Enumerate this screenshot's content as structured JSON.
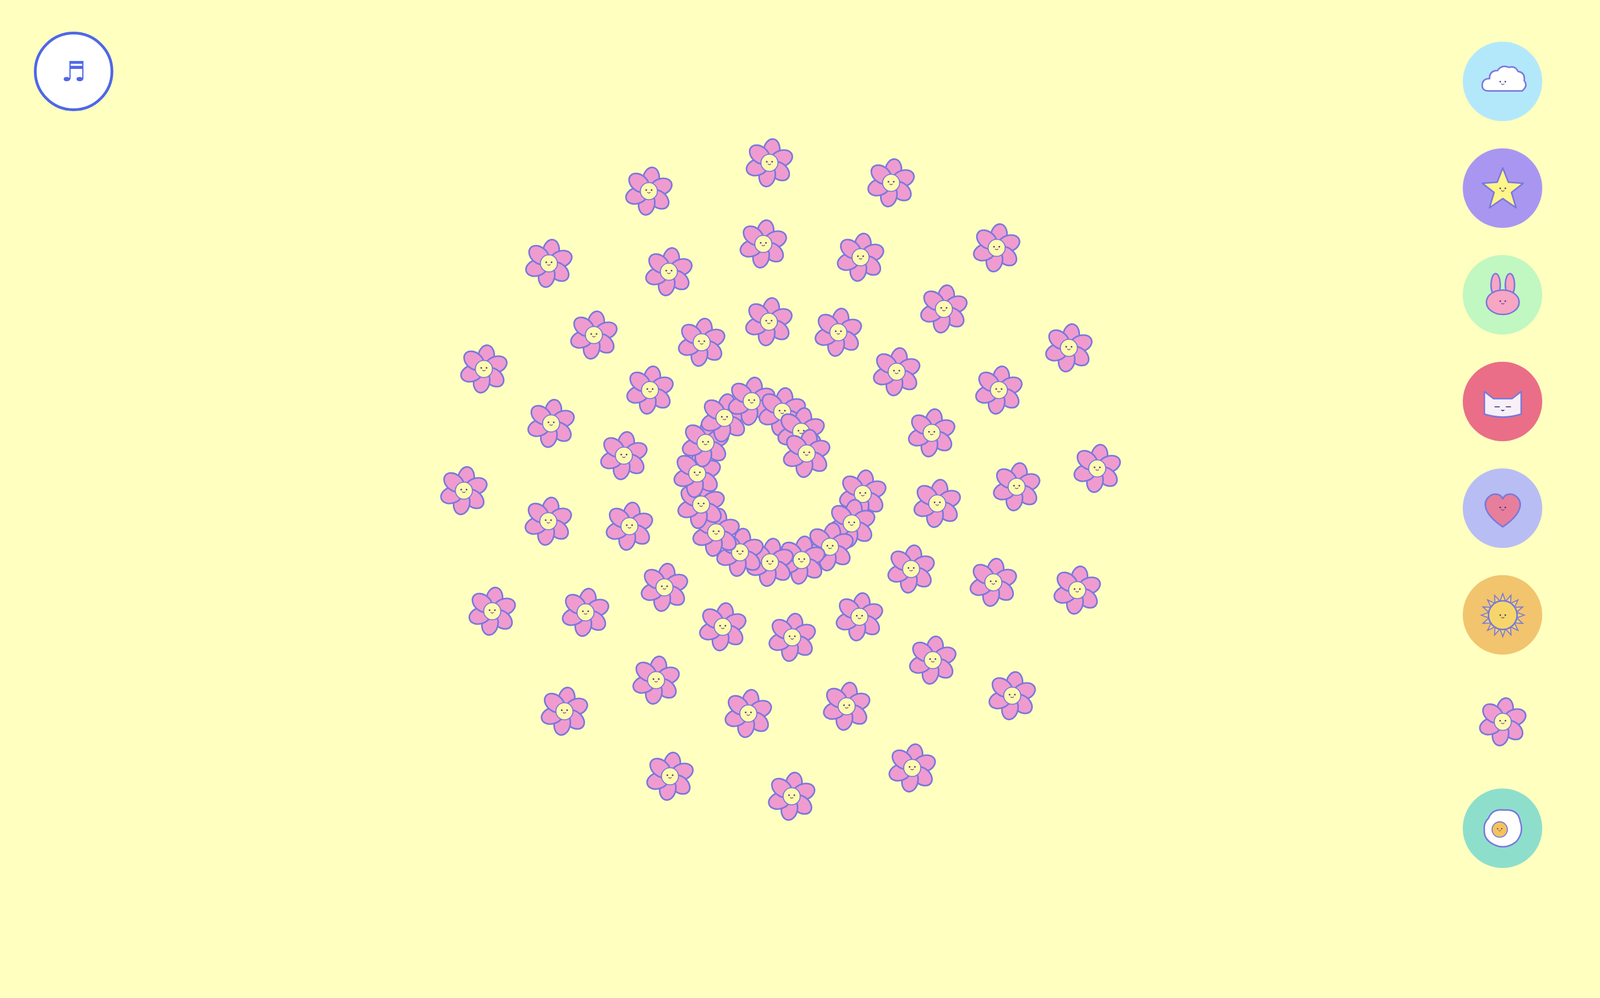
{
  "music_button": {
    "icon": "♬"
  },
  "stamp_palette": [
    {
      "kind": "cloud",
      "selected": false
    },
    {
      "kind": "star",
      "selected": false
    },
    {
      "kind": "bunny",
      "selected": false
    },
    {
      "kind": "cat",
      "selected": false
    },
    {
      "kind": "heart",
      "selected": false
    },
    {
      "kind": "sun",
      "selected": false
    },
    {
      "kind": "flower",
      "selected": true
    },
    {
      "kind": "egg",
      "selected": false
    }
  ],
  "canvas": {
    "stamps": [
      {
        "kind": "flower"
      },
      {
        "kind": "flower"
      },
      {
        "kind": "flower"
      },
      {
        "kind": "flower"
      },
      {
        "kind": "flower"
      },
      {
        "kind": "flower"
      },
      {
        "kind": "flower"
      },
      {
        "kind": "flower"
      },
      {
        "kind": "flower"
      },
      {
        "kind": "flower"
      },
      {
        "kind": "flower"
      },
      {
        "kind": "flower"
      },
      {
        "kind": "flower"
      },
      {
        "kind": "flower"
      },
      {
        "kind": "flower"
      },
      {
        "kind": "flower"
      },
      {
        "kind": "flower"
      },
      {
        "kind": "flower"
      },
      {
        "kind": "flower"
      },
      {
        "kind": "flower"
      },
      {
        "kind": "flower"
      },
      {
        "kind": "flower"
      },
      {
        "kind": "flower"
      },
      {
        "kind": "flower"
      },
      {
        "kind": "flower"
      },
      {
        "kind": "flower"
      },
      {
        "kind": "flower"
      },
      {
        "kind": "flower"
      },
      {
        "kind": "flower"
      },
      {
        "kind": "flower"
      },
      {
        "kind": "flower"
      },
      {
        "kind": "flower"
      },
      {
        "kind": "flower"
      },
      {
        "kind": "flower"
      },
      {
        "kind": "flower"
      },
      {
        "kind": "flower"
      },
      {
        "kind": "flower"
      },
      {
        "kind": "flower"
      },
      {
        "kind": "flower"
      },
      {
        "kind": "flower"
      },
      {
        "kind": "flower"
      },
      {
        "kind": "flower"
      },
      {
        "kind": "flower"
      },
      {
        "kind": "flower"
      },
      {
        "kind": "flower"
      },
      {
        "kind": "flower"
      },
      {
        "kind": "flower"
      },
      {
        "kind": "flower"
      },
      {
        "kind": "flower"
      },
      {
        "kind": "flower"
      },
      {
        "kind": "flower"
      },
      {
        "kind": "flower"
      },
      {
        "kind": "flower"
      },
      {
        "kind": "flower"
      },
      {
        "kind": "flower"
      },
      {
        "kind": "flower"
      },
      {
        "kind": "flower"
      },
      {
        "kind": "flower"
      },
      {
        "kind": "flower"
      },
      {
        "kind": "flower"
      }
    ]
  }
}
